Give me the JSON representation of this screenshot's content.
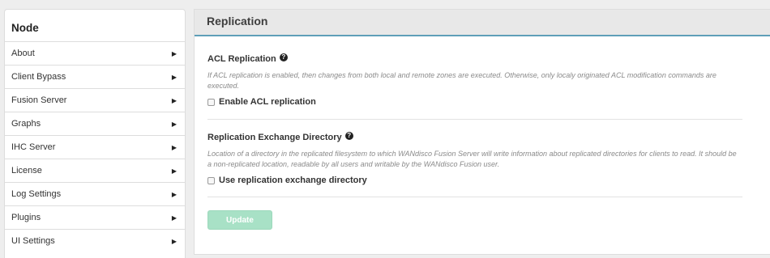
{
  "sidebar": {
    "title": "Node",
    "items": [
      {
        "label": "About"
      },
      {
        "label": "Client Bypass"
      },
      {
        "label": "Fusion Server"
      },
      {
        "label": "Graphs"
      },
      {
        "label": "IHC Server"
      },
      {
        "label": "License"
      },
      {
        "label": "Log Settings"
      },
      {
        "label": "Plugins"
      },
      {
        "label": "UI Settings"
      }
    ],
    "arrow_icon": "caret-right-icon"
  },
  "panel": {
    "title": "Replication",
    "acl": {
      "title": "ACL Replication",
      "help_icon": "?",
      "description": "If ACL replication is enabled, then changes from both local and remote zones are executed. Otherwise, only localy originated ACL modification commands are executed.",
      "checkbox_label": "Enable ACL replication",
      "checked": false
    },
    "exchange": {
      "title": "Replication Exchange Directory",
      "help_icon": "?",
      "description": "Location of a directory in the replicated filesystem to which WANdisco Fusion Server will write information about replicated directories for clients to read. It should be a non-replicated location, readable by all users and writable by the WANdisco Fusion user.",
      "checkbox_label": "Use replication exchange directory",
      "checked": false
    },
    "update_label": "Update"
  },
  "colors": {
    "header_accent": "#5e9fb8",
    "update_button_disabled": "#a8e1c6"
  }
}
